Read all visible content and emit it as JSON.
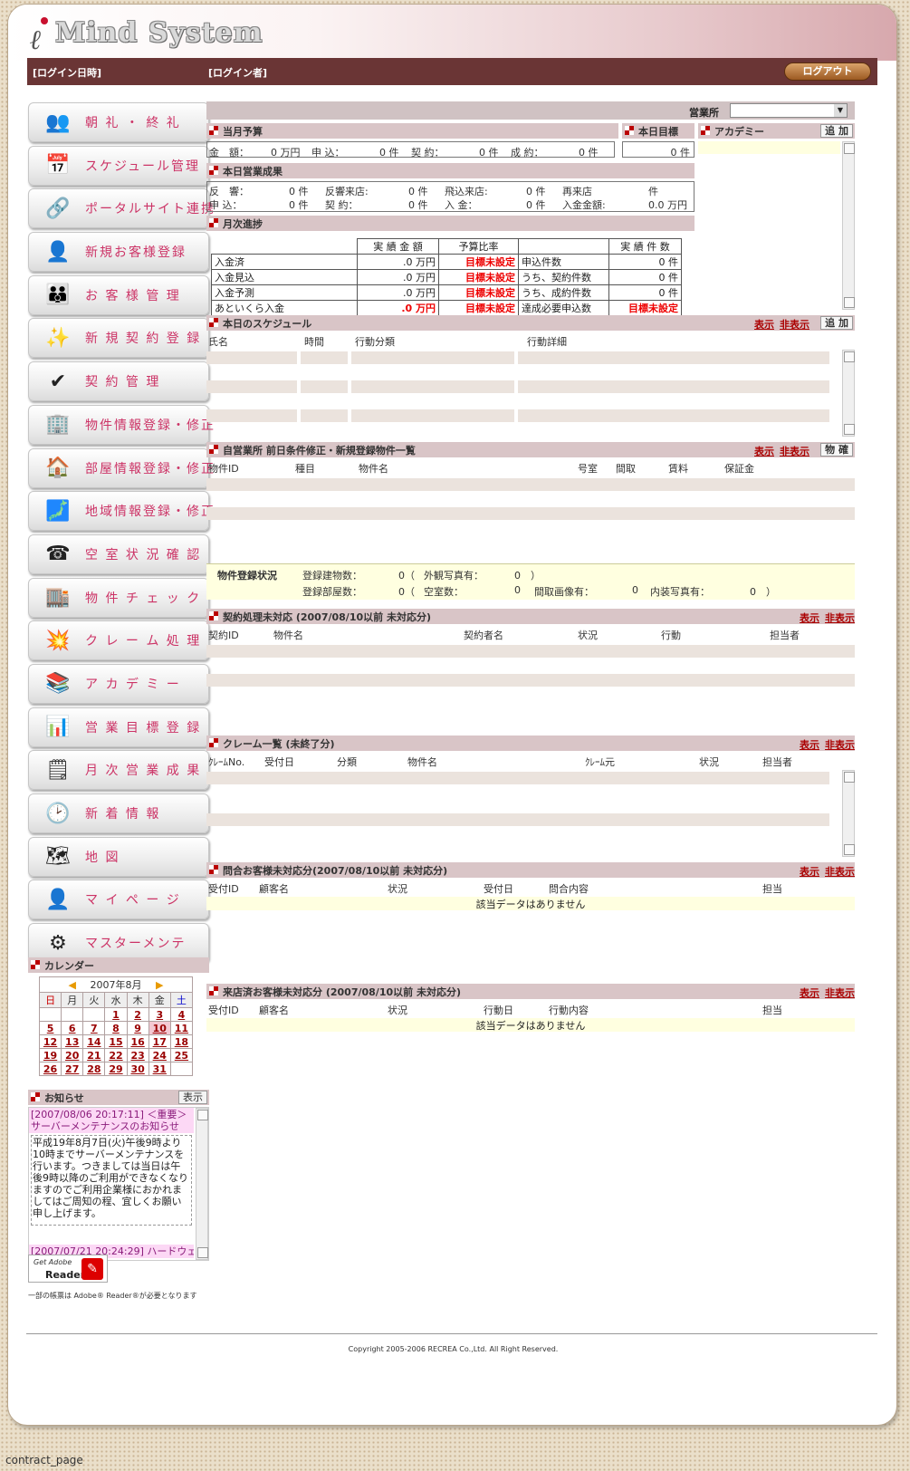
{
  "app": {
    "title": "Mind System",
    "login_date": "[ログイン日時]",
    "login_user": "[ログイン者]",
    "logout": "ログアウト"
  },
  "nav": [
    {
      "name": "chorei",
      "label": "朝 礼 ・ 終 礼",
      "icon": "people-icon",
      "glyph": "👥"
    },
    {
      "name": "schedule",
      "label": "スケジュール管理",
      "icon": "calendar-icon",
      "glyph": "📅"
    },
    {
      "name": "portal",
      "label": "ポータルサイト連携",
      "icon": "link-icon",
      "glyph": "🔗"
    },
    {
      "name": "new-customer",
      "label": "新規お客様登録",
      "icon": "user-add-icon",
      "glyph": "👤"
    },
    {
      "name": "customer",
      "label": "お 客 様 管 理",
      "icon": "users-icon",
      "glyph": "👪"
    },
    {
      "name": "new-contract",
      "label": "新 規 契 約 登 録",
      "icon": "sparkle-doc-icon",
      "glyph": "✨"
    },
    {
      "name": "contract",
      "label": "契 約 管 理",
      "icon": "check-doc-icon",
      "glyph": "✔"
    },
    {
      "name": "property",
      "label": "物件情報登録・修正",
      "icon": "building-icon",
      "glyph": "🏢"
    },
    {
      "name": "room",
      "label": "部屋情報登録・修正",
      "icon": "room-icon",
      "glyph": "🏠"
    },
    {
      "name": "area",
      "label": "地域情報登録・修正",
      "icon": "area-icon",
      "glyph": "🗾"
    },
    {
      "name": "vacancy",
      "label": "空 室 状 況 確 認",
      "icon": "phone-icon",
      "glyph": "☎"
    },
    {
      "name": "check",
      "label": "物 件 チ ェ ッ ク",
      "icon": "check-stamp-icon",
      "glyph": "🏬"
    },
    {
      "name": "claim",
      "label": "ク レ ー ム 処 理",
      "icon": "burst-icon",
      "glyph": "💥"
    },
    {
      "name": "academy",
      "label": "ア カ デ ミ ー",
      "icon": "book-icon",
      "glyph": "📚"
    },
    {
      "name": "goal",
      "label": "営 業 目 標 登 録",
      "icon": "target-icon",
      "glyph": "📊"
    },
    {
      "name": "monthly",
      "label": "月 次 営 業 成 果",
      "icon": "report-icon",
      "glyph": "🗒"
    },
    {
      "name": "news",
      "label": "新 着 情 報",
      "icon": "clock-icon",
      "glyph": "🕑"
    },
    {
      "name": "map",
      "label": "地 図",
      "icon": "map-icon",
      "glyph": "🗺"
    },
    {
      "name": "mypage",
      "label": "マ イ ペ ー ジ",
      "icon": "mypage-icon",
      "glyph": "👤"
    },
    {
      "name": "master",
      "label": "マスターメンテ",
      "icon": "gear-icon",
      "glyph": "⚙"
    }
  ],
  "calendar": {
    "title": "カレンダー",
    "month": "2007年8月",
    "dow": [
      "日",
      "月",
      "火",
      "水",
      "木",
      "金",
      "土"
    ],
    "weeks": [
      [
        "",
        "",
        "",
        "1",
        "2",
        "3",
        "4"
      ],
      [
        "5",
        "6",
        "7",
        "8",
        "9",
        "10",
        "11"
      ],
      [
        "12",
        "13",
        "14",
        "15",
        "16",
        "17",
        "18"
      ],
      [
        "19",
        "20",
        "21",
        "22",
        "23",
        "24",
        "25"
      ],
      [
        "26",
        "27",
        "28",
        "29",
        "30",
        "31",
        ""
      ]
    ]
  },
  "notice": {
    "title": "お知らせ",
    "button": "表示",
    "item1_head": "[2007/08/06 20:17:11] ＜重要＞サーバーメンテナンスのお知らせ",
    "item1_body": "平成19年8月7日(火)午後9時より10時までサーバーメンテナンスを行います。つきましては当日は午後9時以降のご利用ができなくなりますのでご利用企業様におかれましてはご周知の程、宜しくお願い申し上げます。",
    "item2_head": "[2007/07/21 20:24:29] ハードウェ"
  },
  "adobe": {
    "get": "Get Adobe",
    "reader": "Reader",
    "note": "一部の帳票は Adobe® Reader®が必要となります"
  },
  "office": {
    "label": "営業所"
  },
  "budget": {
    "title": "当月予算",
    "kingaku": "金　額：",
    "kingaku_v": "0 万円",
    "moushikomi": "申 込：",
    "moushikomi_v": "0 件",
    "keiyaku": "契 約：",
    "keiyaku_v": "0 件",
    "seiyaku": "成 約：",
    "seiyaku_v": "0 件"
  },
  "goal": {
    "title": "本日目標",
    "value": "0 件"
  },
  "academy": {
    "title": "アカデミー",
    "add": "追 加"
  },
  "today": {
    "title": "本日営業成果",
    "r1": [
      "反　響：",
      "0 件",
      "反響来店:",
      "0 件",
      "飛込来店:",
      "0 件",
      "再来店",
      "件"
    ],
    "r2": [
      "申 込：",
      "0 件",
      "契 約：",
      "0 件",
      "入 金：",
      "0 件",
      "入金金額:",
      "0.0 万円"
    ]
  },
  "monthly": {
    "title": "月次進捗",
    "h1": "実 績 金 額",
    "h2": "予算比率",
    "h3": "実 績 件 数",
    "rows": [
      [
        "入金済",
        ".0 万円",
        "目標未設定",
        "申込件数",
        "0 件"
      ],
      [
        "入金見込",
        ".0 万円",
        "目標未設定",
        "うち、契約件数",
        "0 件"
      ],
      [
        "入金予測",
        ".0 万円",
        "目標未設定",
        "うち、成約件数",
        "0 件"
      ],
      [
        "あといくら入金",
        ".0 万円",
        "目標未設定",
        "達成必要申込数",
        "目標未設定"
      ]
    ]
  },
  "schedule": {
    "title": "本日のスケジュール",
    "show": "表示",
    "hide": "非表示",
    "add": "追 加",
    "cols": [
      "氏名",
      "時間",
      "行動分類",
      "行動詳細"
    ]
  },
  "property": {
    "title": "自営業所 前日条件修正・新規登録物件一覧",
    "show": "表示",
    "hide": "非表示",
    "btn": "物 確",
    "cols": [
      "物件ID",
      "種目",
      "物件名",
      "号室",
      "間取",
      "賃料",
      "保証金"
    ],
    "status_title": "物件登録状況",
    "r1": [
      "登録建物数：",
      "0（",
      "外観写真有：",
      "0　）"
    ],
    "r2": [
      "登録部屋数：",
      "0（",
      "空室数：",
      "0",
      "間取画像有：",
      "0",
      "内装写真有：",
      "0　）"
    ]
  },
  "contract": {
    "title": "契約処理未対応 (2007/08/10以前 未対応分)",
    "show": "表示",
    "hide": "非表示",
    "cols": [
      "契約ID",
      "物件名",
      "契約者名",
      "状況",
      "行動",
      "担当者"
    ]
  },
  "claim": {
    "title": "クレーム一覧 (未終了分)",
    "show": "表示",
    "hide": "非表示",
    "cols": [
      "ｸﾚｰﾑNo.",
      "受付日",
      "分類",
      "物件名",
      "ｸﾚｰﾑ元",
      "状況",
      "担当者"
    ]
  },
  "inquiry": {
    "title": "問合お客様未対応分(2007/08/10以前 未対応分)",
    "show": "表示",
    "hide": "非表示",
    "cols": [
      "受付ID",
      "顧客名",
      "状況",
      "受付日",
      "問合内容",
      "担当"
    ],
    "nodata": "該当データはありません"
  },
  "visit": {
    "title": "来店済お客様未対応分 (2007/08/10以前 未対応分)",
    "show": "表示",
    "hide": "非表示",
    "cols": [
      "受付ID",
      "顧客名",
      "状況",
      "行動日",
      "行動内容",
      "担当"
    ],
    "nodata": "該当データはありません"
  },
  "footer": {
    "copyright": "Copyright 2005-2006 RECREA Co.,Ltd. All Right Reserved.",
    "page": "contract_page"
  }
}
